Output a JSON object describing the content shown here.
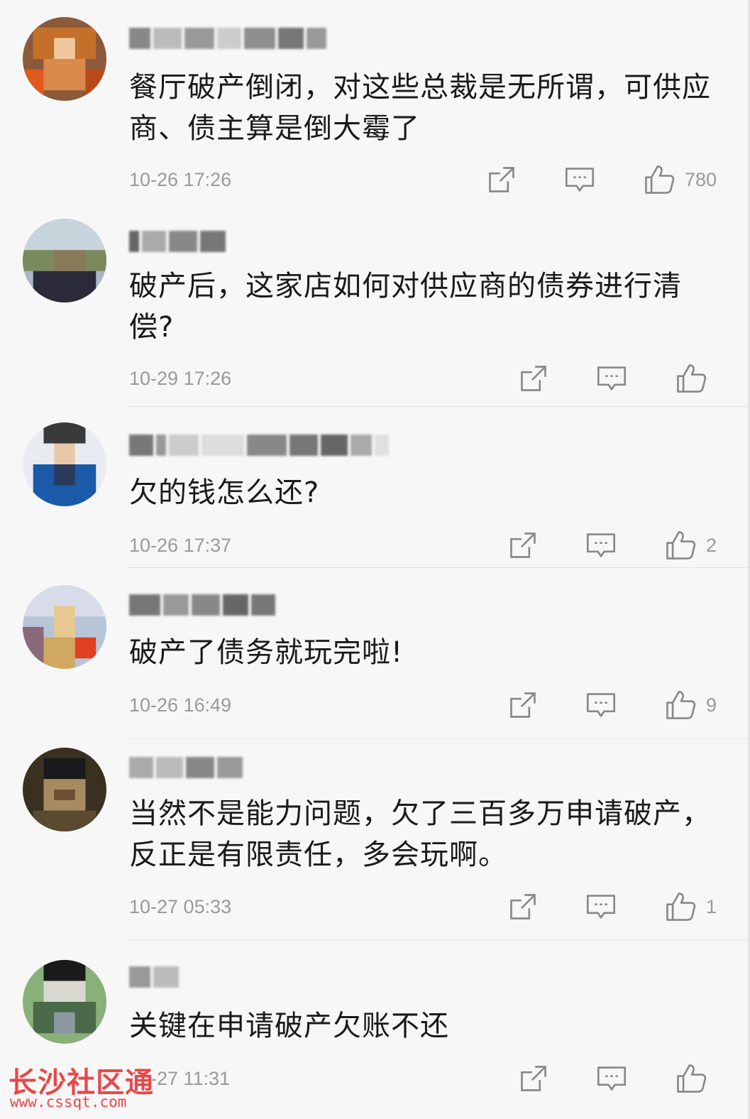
{
  "comments": [
    {
      "text": "餐厅破产倒闭，对这些总裁是无所谓，可供应商、债主算是倒大霉了",
      "time": "10-26 17:26",
      "likes": "780"
    },
    {
      "text": "破产后，这家店如何对供应商的债券进行清偿?",
      "time": "10-29 17:26",
      "likes": ""
    },
    {
      "text": "欠的钱怎么还?",
      "time": "10-26 17:37",
      "likes": "2"
    },
    {
      "text": "破产了债务就玩完啦!",
      "time": "10-26 16:49",
      "likes": "9"
    },
    {
      "text": "当然不是能力问题，欠了三百多万申请破产，反正是有限责任，多会玩啊。",
      "time": "10-27 05:33",
      "likes": "1"
    },
    {
      "text": "关键在申请破产欠账不还",
      "time": "10-27 11:31",
      "likes": ""
    }
  ],
  "icons": {
    "share": "share-icon",
    "reply": "comment-icon",
    "like": "thumbs-up-icon"
  },
  "colors": {
    "watermark": "#e8484a",
    "meta": "#9a9a9a"
  },
  "watermark": {
    "title": "长沙社区通",
    "url": "www.cssqt.com"
  }
}
